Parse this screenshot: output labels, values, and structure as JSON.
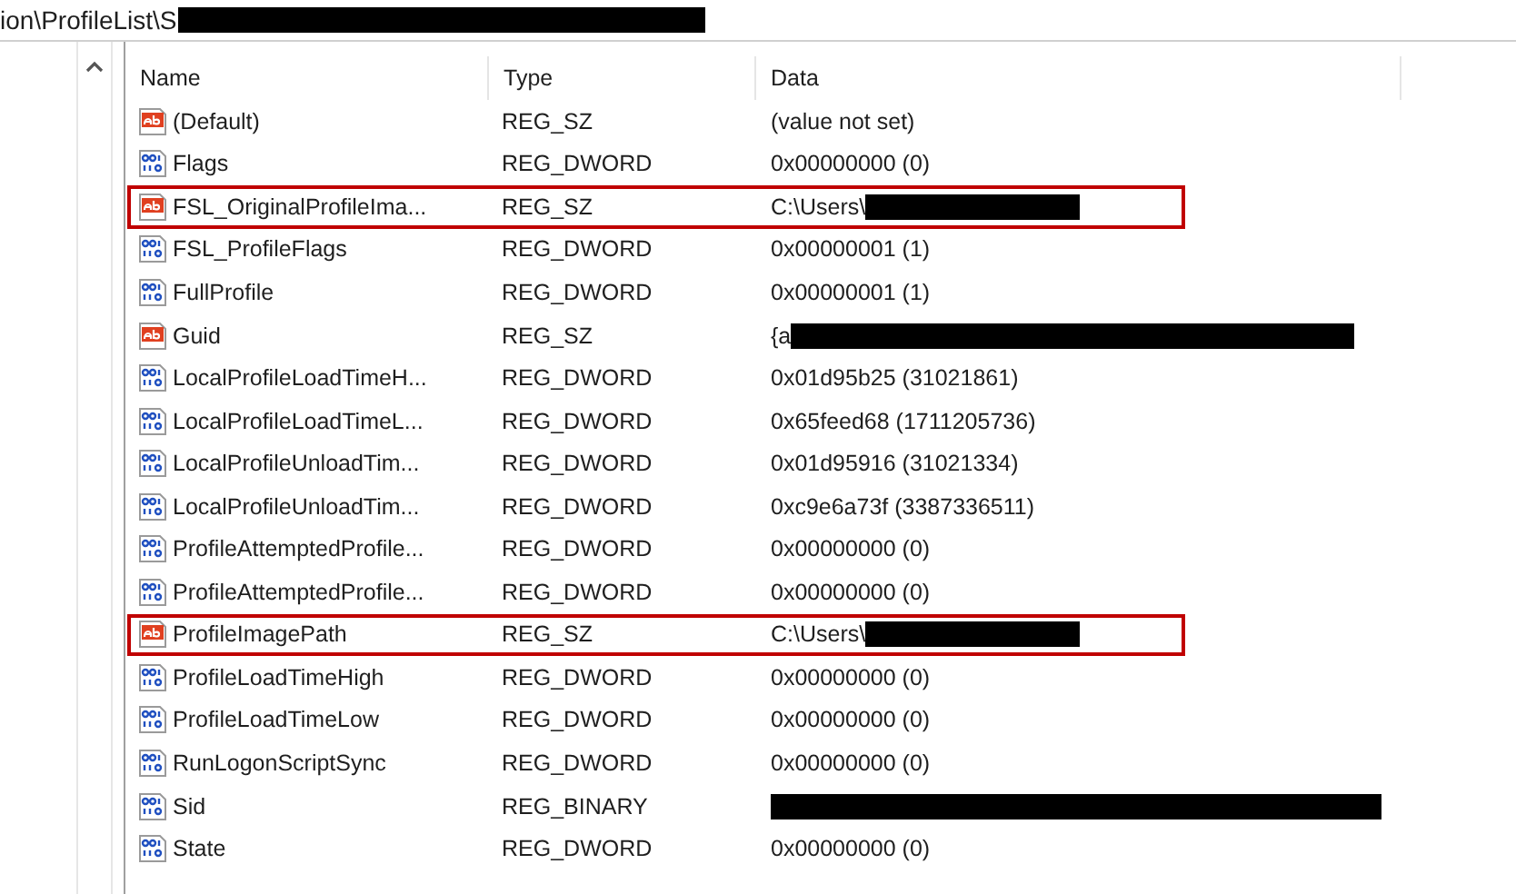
{
  "address_bar": {
    "path": "ion\\ProfileList\\S",
    "redacted": true
  },
  "table": {
    "columns": [
      "Name",
      "Type",
      "Data"
    ],
    "rows": [
      {
        "kind": "string",
        "name": "(Default)",
        "type": "REG_SZ",
        "data": "(value not set)",
        "redacted": false,
        "highlighted": false
      },
      {
        "kind": "binary",
        "name": "Flags",
        "type": "REG_DWORD",
        "data": "0x00000000 (0)",
        "redacted": false,
        "highlighted": false
      },
      {
        "kind": "string",
        "name": "FSL_OriginalProfileIma...",
        "type": "REG_SZ",
        "data": "C:\\Users\\",
        "redacted": true,
        "highlighted": true
      },
      {
        "kind": "binary",
        "name": "FSL_ProfileFlags",
        "type": "REG_DWORD",
        "data": "0x00000001 (1)",
        "redacted": false,
        "highlighted": false
      },
      {
        "kind": "binary",
        "name": "FullProfile",
        "type": "REG_DWORD",
        "data": "0x00000001 (1)",
        "redacted": false,
        "highlighted": false
      },
      {
        "kind": "string",
        "name": "Guid",
        "type": "REG_SZ",
        "data": "{a",
        "redacted": true,
        "highlighted": false
      },
      {
        "kind": "binary",
        "name": "LocalProfileLoadTimeH...",
        "type": "REG_DWORD",
        "data": "0x01d95b25 (31021861)",
        "redacted": false,
        "highlighted": false
      },
      {
        "kind": "binary",
        "name": "LocalProfileLoadTimeL...",
        "type": "REG_DWORD",
        "data": "0x65feed68 (1711205736)",
        "redacted": false,
        "highlighted": false
      },
      {
        "kind": "binary",
        "name": "LocalProfileUnloadTim...",
        "type": "REG_DWORD",
        "data": "0x01d95916 (31021334)",
        "redacted": false,
        "highlighted": false
      },
      {
        "kind": "binary",
        "name": "LocalProfileUnloadTim...",
        "type": "REG_DWORD",
        "data": "0xc9e6a73f (3387336511)",
        "redacted": false,
        "highlighted": false
      },
      {
        "kind": "binary",
        "name": "ProfileAttemptedProfile...",
        "type": "REG_DWORD",
        "data": "0x00000000 (0)",
        "redacted": false,
        "highlighted": false
      },
      {
        "kind": "binary",
        "name": "ProfileAttemptedProfile...",
        "type": "REG_DWORD",
        "data": "0x00000000 (0)",
        "redacted": false,
        "highlighted": false
      },
      {
        "kind": "string",
        "name": "ProfileImagePath",
        "type": "REG_SZ",
        "data": "C:\\Users\\",
        "redacted": true,
        "highlighted": true
      },
      {
        "kind": "binary",
        "name": "ProfileLoadTimeHigh",
        "type": "REG_DWORD",
        "data": "0x00000000 (0)",
        "redacted": false,
        "highlighted": false
      },
      {
        "kind": "binary",
        "name": "ProfileLoadTimeLow",
        "type": "REG_DWORD",
        "data": "0x00000000 (0)",
        "redacted": false,
        "highlighted": false
      },
      {
        "kind": "binary",
        "name": "RunLogonScriptSync",
        "type": "REG_DWORD",
        "data": "0x00000000 (0)",
        "redacted": false,
        "highlighted": false
      },
      {
        "kind": "binary",
        "name": "Sid",
        "type": "REG_BINARY",
        "redacted": true,
        "highlighted": false
      },
      {
        "kind": "binary",
        "name": "State",
        "type": "REG_DWORD",
        "data": "0x00000000 (0)",
        "redacted": false,
        "highlighted": false
      }
    ]
  }
}
